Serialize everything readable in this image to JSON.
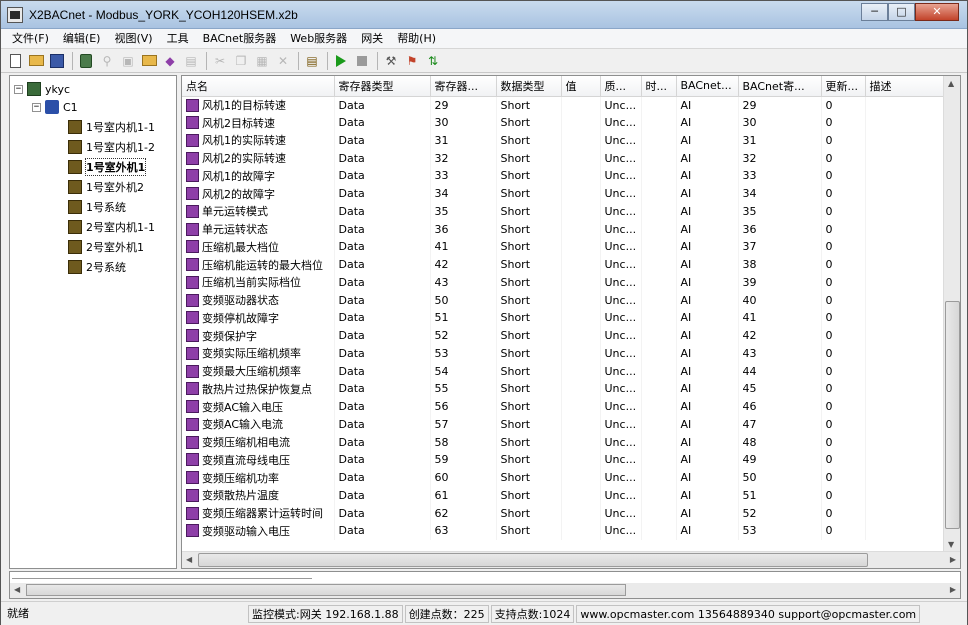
{
  "window": {
    "title": "X2BACnet - Modbus_YORK_YCOH120HSEM.x2b",
    "min": "─",
    "max": "□",
    "close": "✕"
  },
  "menu": [
    "文件(F)",
    "编辑(E)",
    "视图(V)",
    "工具",
    "BACnet服务器",
    "Web服务器",
    "网关",
    "帮助(H)"
  ],
  "tree": {
    "root": "ykyc",
    "channel": "C1",
    "devices": [
      "1号室内机1-1",
      "1号室内机1-2",
      "1号室外机1",
      "1号室外机2",
      "1号系统",
      "2号室内机1-1",
      "2号室外机1",
      "2号系统"
    ],
    "selected_index": 2
  },
  "table": {
    "columns": [
      "点名",
      "寄存器类型",
      "寄存器...",
      "数据类型",
      "值",
      "质...",
      "时...",
      "BACnet...",
      "BACnet寄...",
      "更新...",
      "描述"
    ],
    "rows": [
      [
        "风机1的目标转速",
        "Data",
        "29",
        "Short",
        "",
        "Unc...",
        "",
        "AI",
        "29",
        "0",
        ""
      ],
      [
        "风机2目标转速",
        "Data",
        "30",
        "Short",
        "",
        "Unc...",
        "",
        "AI",
        "30",
        "0",
        ""
      ],
      [
        "风机1的实际转速",
        "Data",
        "31",
        "Short",
        "",
        "Unc...",
        "",
        "AI",
        "31",
        "0",
        ""
      ],
      [
        "风机2的实际转速",
        "Data",
        "32",
        "Short",
        "",
        "Unc...",
        "",
        "AI",
        "32",
        "0",
        ""
      ],
      [
        "风机1的故障字",
        "Data",
        "33",
        "Short",
        "",
        "Unc...",
        "",
        "AI",
        "33",
        "0",
        ""
      ],
      [
        "风机2的故障字",
        "Data",
        "34",
        "Short",
        "",
        "Unc...",
        "",
        "AI",
        "34",
        "0",
        ""
      ],
      [
        "单元运转模式",
        "Data",
        "35",
        "Short",
        "",
        "Unc...",
        "",
        "AI",
        "35",
        "0",
        ""
      ],
      [
        "单元运转状态",
        "Data",
        "36",
        "Short",
        "",
        "Unc...",
        "",
        "AI",
        "36",
        "0",
        ""
      ],
      [
        "压缩机最大档位",
        "Data",
        "41",
        "Short",
        "",
        "Unc...",
        "",
        "AI",
        "37",
        "0",
        ""
      ],
      [
        "压缩机能运转的最大档位",
        "Data",
        "42",
        "Short",
        "",
        "Unc...",
        "",
        "AI",
        "38",
        "0",
        ""
      ],
      [
        "压缩机当前实际档位",
        "Data",
        "43",
        "Short",
        "",
        "Unc...",
        "",
        "AI",
        "39",
        "0",
        ""
      ],
      [
        "变频驱动器状态",
        "Data",
        "50",
        "Short",
        "",
        "Unc...",
        "",
        "AI",
        "40",
        "0",
        ""
      ],
      [
        "变频停机故障字",
        "Data",
        "51",
        "Short",
        "",
        "Unc...",
        "",
        "AI",
        "41",
        "0",
        ""
      ],
      [
        "变频保护字",
        "Data",
        "52",
        "Short",
        "",
        "Unc...",
        "",
        "AI",
        "42",
        "0",
        ""
      ],
      [
        "变频实际压缩机频率",
        "Data",
        "53",
        "Short",
        "",
        "Unc...",
        "",
        "AI",
        "43",
        "0",
        ""
      ],
      [
        "变频最大压缩机频率",
        "Data",
        "54",
        "Short",
        "",
        "Unc...",
        "",
        "AI",
        "44",
        "0",
        ""
      ],
      [
        "散热片过热保护恢复点",
        "Data",
        "55",
        "Short",
        "",
        "Unc...",
        "",
        "AI",
        "45",
        "0",
        ""
      ],
      [
        "变频AC输入电压",
        "Data",
        "56",
        "Short",
        "",
        "Unc...",
        "",
        "AI",
        "46",
        "0",
        ""
      ],
      [
        "变频AC输入电流",
        "Data",
        "57",
        "Short",
        "",
        "Unc...",
        "",
        "AI",
        "47",
        "0",
        ""
      ],
      [
        "变频压缩机相电流",
        "Data",
        "58",
        "Short",
        "",
        "Unc...",
        "",
        "AI",
        "48",
        "0",
        ""
      ],
      [
        "变频直流母线电压",
        "Data",
        "59",
        "Short",
        "",
        "Unc...",
        "",
        "AI",
        "49",
        "0",
        ""
      ],
      [
        "变频压缩机功率",
        "Data",
        "60",
        "Short",
        "",
        "Unc...",
        "",
        "AI",
        "50",
        "0",
        ""
      ],
      [
        "变频散热片温度",
        "Data",
        "61",
        "Short",
        "",
        "Unc...",
        "",
        "AI",
        "51",
        "0",
        ""
      ],
      [
        "变频压缩器累计运转时间",
        "Data",
        "62",
        "Short",
        "",
        "Unc...",
        "",
        "AI",
        "52",
        "0",
        ""
      ],
      [
        "变频驱动输入电压",
        "Data",
        "63",
        "Short",
        "",
        "Unc...",
        "",
        "AI",
        "53",
        "0",
        ""
      ]
    ]
  },
  "status": {
    "ready": "就绪",
    "mode": "监控模式:网关 192.168.1.88",
    "created": "创建点数：225",
    "supported": "支持点数:1024",
    "contact": "www.opcmaster.com 13564889340 support@opcmaster.com"
  },
  "colors": {
    "title_bar": "#a9c3e1",
    "tag_icon": "#8e3fa8",
    "close_btn": "#c2432a"
  },
  "toolbar_icons": [
    "new-icon",
    "open-icon",
    "save-icon",
    "add-server-icon",
    "add-channel-icon",
    "add-device-icon",
    "add-tag-icon",
    "import-icon",
    "export-icon",
    "cut-icon",
    "copy-icon",
    "paste-icon",
    "delete-icon",
    "monitor-icon",
    "run-icon",
    "stop-icon",
    "tools-icon",
    "gateway-icon",
    "bacnet-icon"
  ]
}
